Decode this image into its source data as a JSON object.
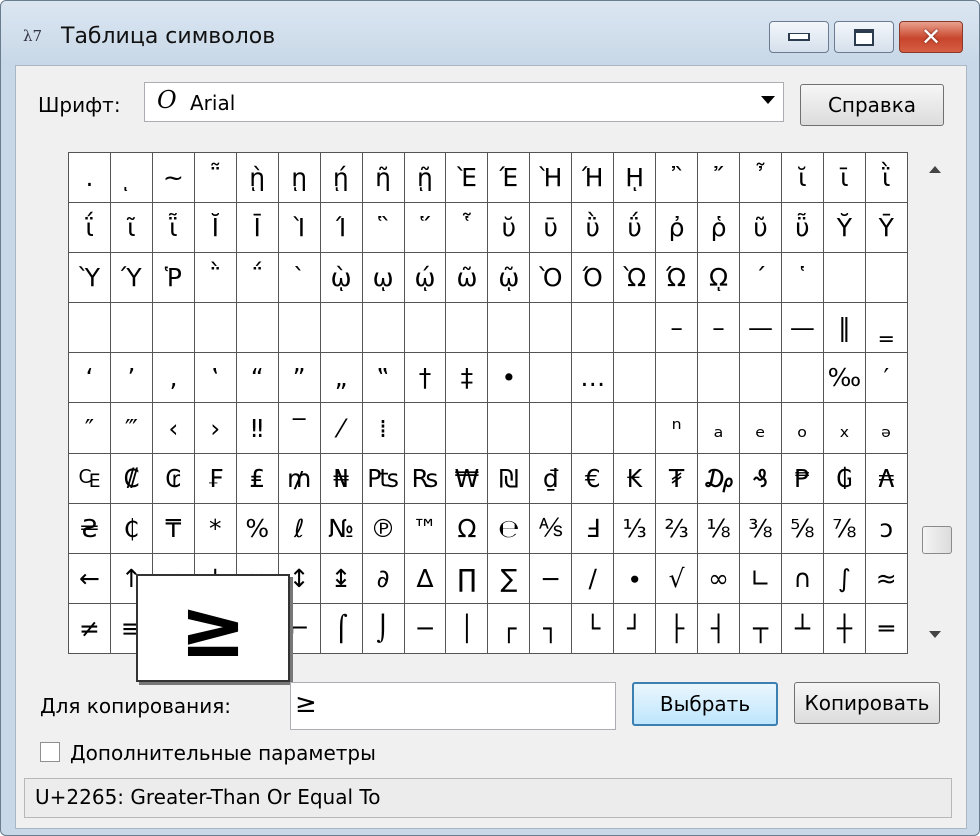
{
  "window": {
    "title": "Таблица символов",
    "icon": "charmap-icon",
    "icon_text": "λ7"
  },
  "titlebar_buttons": {
    "minimize": "minimize-icon",
    "maximize": "maximize-icon",
    "close": "close-icon",
    "close_glyph": "✕"
  },
  "font": {
    "label": "Шрифт:",
    "icon_glyph": "O",
    "value": "Arial",
    "help_label": "Справка"
  },
  "grid": {
    "rows": [
      [
        ".",
        "ͅ",
        "~",
        "῁",
        "ῂ",
        "ῃ",
        "ῄ",
        "ῆ",
        "ῇ",
        "Ὲ",
        "Έ",
        "Ὴ",
        "Ή",
        "ῌ",
        "῍",
        "῎",
        "῏",
        "ῐ",
        "ῑ",
        "ῒ"
      ],
      [
        "ΐ",
        "ῖ",
        "ῗ",
        "Ῐ",
        "Ῑ",
        "Ὶ",
        "Ί",
        "῝",
        "῞",
        "῟",
        "ῠ",
        "ῡ",
        "ῢ",
        "ΰ",
        "ῤ",
        "ῥ",
        "ῦ",
        "ῧ",
        "Ῠ",
        "Ῡ"
      ],
      [
        "Ὺ",
        "Ύ",
        "Ῥ",
        "῭",
        "΅",
        "`",
        "ῲ",
        "ῳ",
        "ῴ",
        "ῶ",
        "ῷ",
        "Ὸ",
        "Ό",
        "Ὼ",
        "Ώ",
        "ῼ",
        "´",
        "῾",
        "",
        ""
      ],
      [
        "",
        "",
        "",
        "",
        "",
        "",
        "",
        "",
        "",
        "",
        "",
        "",
        "",
        "",
        "–",
        "–",
        "—",
        "—",
        "‖",
        "‗"
      ],
      [
        "‘",
        "’",
        "‚",
        "‛",
        "“",
        "”",
        "„",
        "‟",
        "†",
        "‡",
        "•",
        "",
        "…",
        "",
        "",
        "",
        "",
        "",
        "‰",
        "′"
      ],
      [
        "″",
        "‴",
        "‹",
        "›",
        "‼",
        "‾",
        "⁄",
        "⁞",
        "",
        "",
        "",
        "",
        "",
        "",
        "ⁿ",
        "ₐ",
        "ₑ",
        "ₒ",
        "ₓ",
        "ₔ"
      ],
      [
        "₠",
        "₡",
        "₢",
        "₣",
        "₤",
        "₥",
        "₦",
        "₧",
        "₨",
        "₩",
        "₪",
        "₫",
        "€",
        "₭",
        "₮",
        "₯",
        "₰",
        "₱",
        "₲",
        "₳"
      ],
      [
        "₴",
        "₵",
        "₸",
        "*",
        "%",
        "ℓ",
        "№",
        "℗",
        "™",
        "Ω",
        "℮",
        "⅍",
        "Ⅎ",
        "⅓",
        "⅔",
        "⅛",
        "⅜",
        "⅝",
        "⅞",
        "ↄ"
      ],
      [
        "←",
        "↑",
        "→",
        "↓",
        "↔",
        "↕",
        "↨",
        "∂",
        "∆",
        "∏",
        "∑",
        "−",
        "∕",
        "∙",
        "√",
        "∞",
        "∟",
        "∩",
        "∫",
        "≈"
      ],
      [
        "≠",
        "≡",
        "≤",
        "≥",
        "⌂",
        "⌐",
        "⌠",
        "⌡",
        "─",
        "│",
        "┌",
        "┐",
        "└",
        "┘",
        "├",
        "┤",
        "┬",
        "┴",
        "┼",
        "═"
      ]
    ],
    "magnified": "≥"
  },
  "copy": {
    "label": "Для копирования:",
    "value": "≥",
    "select_label": "Выбрать",
    "copy_label": "Копировать"
  },
  "advanced": {
    "label": "Дополнительные параметры",
    "checked": false
  },
  "status": {
    "text": "U+2265: Greater-Than Or Equal To"
  }
}
